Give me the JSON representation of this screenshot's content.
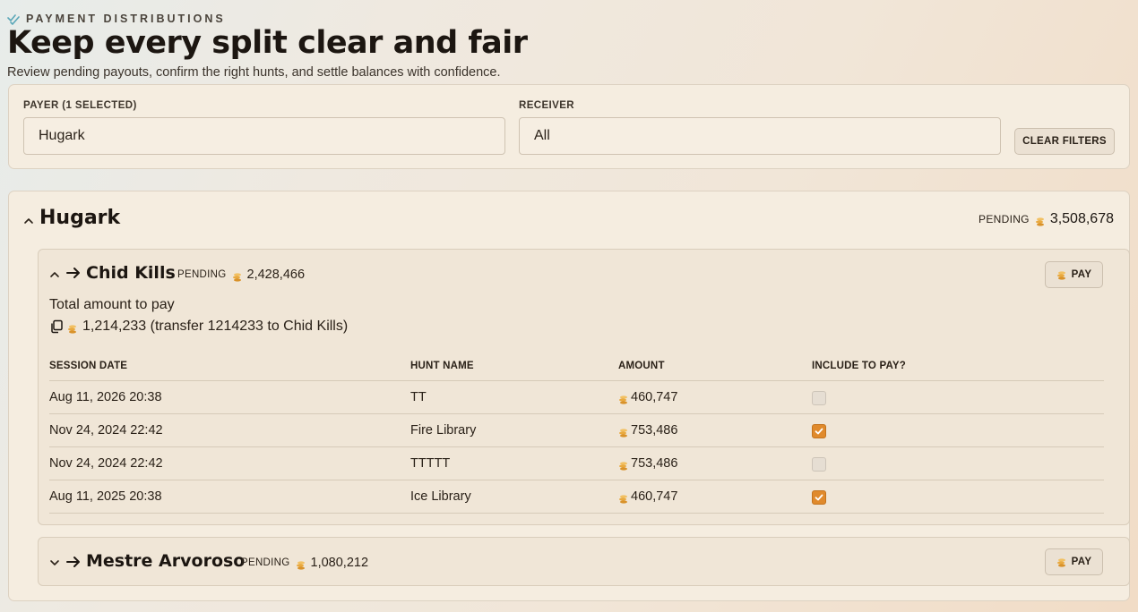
{
  "header": {
    "kicker": "PAYMENT DISTRIBUTIONS",
    "title": "Keep every split clear and fair",
    "subtitle": "Review pending payouts, confirm the right hunts, and settle balances with confidence."
  },
  "filters": {
    "payer_label": "PAYER (1 SELECTED)",
    "payer_value": "Hugark",
    "receiver_label": "RECEIVER",
    "receiver_value": "All",
    "clear_label": "CLEAR FILTERS"
  },
  "payer": {
    "name": "Hugark",
    "pending_label": "PENDING",
    "pending_amount": "3,508,678",
    "receivers": [
      {
        "name": "Chid Kills",
        "pending_label": "PENDING",
        "pending_amount": "2,428,466",
        "pay_label": "PAY",
        "expanded": true,
        "total_label": "Total amount to pay",
        "total_text": "1,214,233 (transfer 1214233 to Chid Kills)",
        "table": {
          "headers": [
            "SESSION DATE",
            "HUNT NAME",
            "AMOUNT",
            "INCLUDE TO PAY?"
          ],
          "rows": [
            {
              "date": "Aug 11, 2026 20:38",
              "hunt": "TT",
              "amount": "460,747",
              "include": false
            },
            {
              "date": "Nov 24, 2024 22:42",
              "hunt": "Fire Library",
              "amount": "753,486",
              "include": true
            },
            {
              "date": "Nov 24, 2024 22:42",
              "hunt": "TTTTT",
              "amount": "753,486",
              "include": false
            },
            {
              "date": "Aug 11, 2025 20:38",
              "hunt": "Ice Library",
              "amount": "460,747",
              "include": true
            }
          ]
        }
      },
      {
        "name": "Mestre Arvoroso",
        "pending_label": "PENDING",
        "pending_amount": "1,080,212",
        "pay_label": "PAY",
        "expanded": false
      }
    ]
  },
  "icons": {
    "kicker": "double-check-icon",
    "coin": "coin-stack-icon",
    "copy": "copy-icon",
    "collapse": "chevron-up-icon",
    "expand": "chevron-down-icon",
    "arrow": "arrow-right-icon"
  },
  "colors": {
    "accent": "#e08a2c",
    "coin": "#e9a93f",
    "kicker_check": "#5aa7b8"
  }
}
